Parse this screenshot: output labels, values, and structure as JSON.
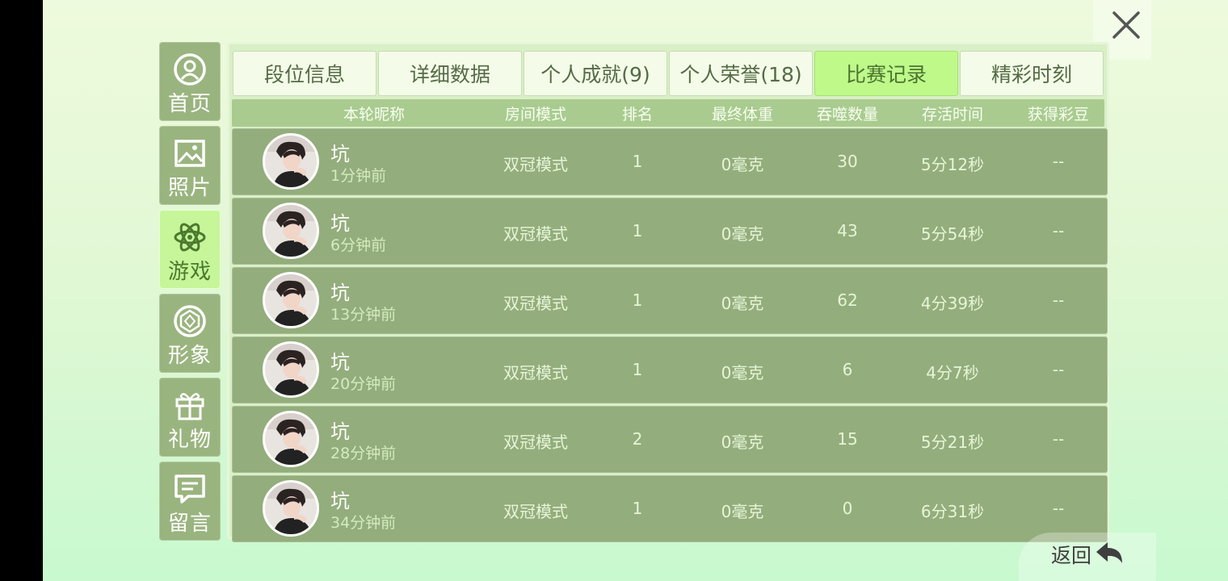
{
  "sidebar": {
    "items": [
      {
        "label": "首页",
        "icon": "home-icon"
      },
      {
        "label": "照片",
        "icon": "photo-icon"
      },
      {
        "label": "游戏",
        "icon": "atom-icon",
        "active": true
      },
      {
        "label": "形象",
        "icon": "diamond-icon"
      },
      {
        "label": "礼物",
        "icon": "gift-icon"
      },
      {
        "label": "留言",
        "icon": "message-icon"
      }
    ]
  },
  "tabs": [
    {
      "label": "段位信息"
    },
    {
      "label": "详细数据"
    },
    {
      "label": "个人成就(9)"
    },
    {
      "label": "个人荣誉(18)"
    },
    {
      "label": "比赛记录",
      "active": true
    },
    {
      "label": "精彩时刻"
    }
  ],
  "table": {
    "headers": {
      "name": "本轮昵称",
      "mode": "房间模式",
      "rank": "排名",
      "weight": "最终体重",
      "eat": "吞噬数量",
      "time": "存活时间",
      "bean": "获得彩豆"
    },
    "rows": [
      {
        "nick": "坑",
        "ago": "1分钟前",
        "mode": "双冠模式",
        "rank": "1",
        "weight": "0毫克",
        "eat": "30",
        "time": "5分12秒",
        "bean": "--"
      },
      {
        "nick": "坑",
        "ago": "6分钟前",
        "mode": "双冠模式",
        "rank": "1",
        "weight": "0毫克",
        "eat": "43",
        "time": "5分54秒",
        "bean": "--"
      },
      {
        "nick": "坑",
        "ago": "13分钟前",
        "mode": "双冠模式",
        "rank": "1",
        "weight": "0毫克",
        "eat": "62",
        "time": "4分39秒",
        "bean": "--"
      },
      {
        "nick": "坑",
        "ago": "20分钟前",
        "mode": "双冠模式",
        "rank": "1",
        "weight": "0毫克",
        "eat": "6",
        "time": "4分7秒",
        "bean": "--"
      },
      {
        "nick": "坑",
        "ago": "28分钟前",
        "mode": "双冠模式",
        "rank": "2",
        "weight": "0毫克",
        "eat": "15",
        "time": "5分21秒",
        "bean": "--"
      },
      {
        "nick": "坑",
        "ago": "34分钟前",
        "mode": "双冠模式",
        "rank": "1",
        "weight": "0毫克",
        "eat": "0",
        "time": "6分31秒",
        "bean": "--"
      }
    ]
  },
  "back": {
    "label": "返回",
    "icon": "back-arrow-icon"
  },
  "close": {
    "icon": "close-icon"
  },
  "colors": {
    "active_tab": "#bff98a",
    "row_bg": "#94ad7c",
    "header_bg": "#aacb90",
    "sidebar_bg": "#9ab47f"
  }
}
